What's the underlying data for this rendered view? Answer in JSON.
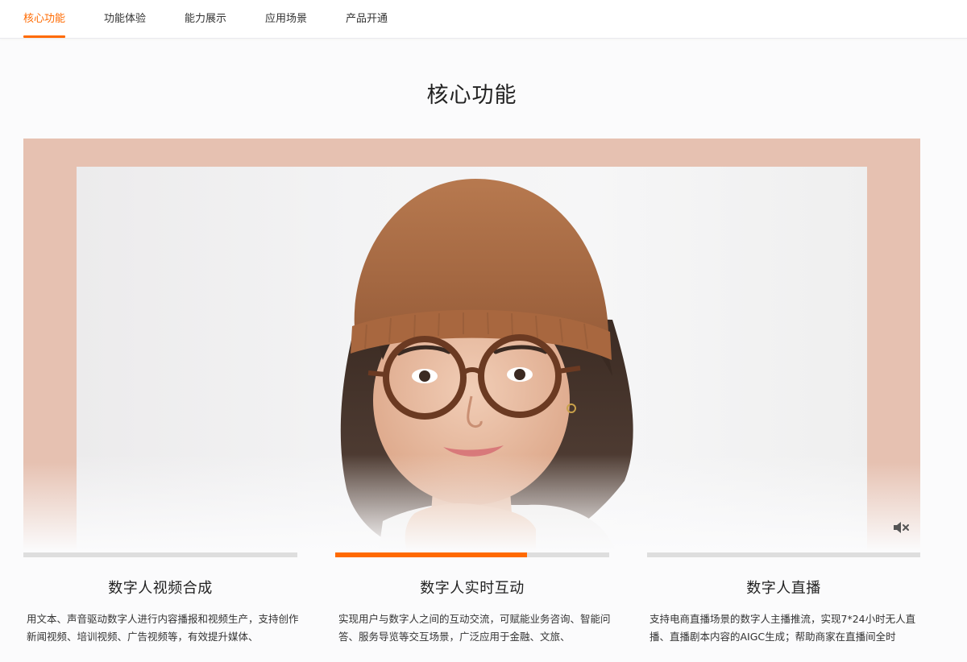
{
  "nav": {
    "tabs": [
      {
        "label": "核心功能",
        "active": true
      },
      {
        "label": "功能体验",
        "active": false
      },
      {
        "label": "能力展示",
        "active": false
      },
      {
        "label": "应用场景",
        "active": false
      },
      {
        "label": "产品开通",
        "active": false
      }
    ]
  },
  "section": {
    "title": "核心功能"
  },
  "media": {
    "type": "video",
    "muted": true,
    "mute_icon": "volume-mute-icon",
    "subject": "portrait"
  },
  "features": [
    {
      "title": "数字人视频合成",
      "description": "用文本、声音驱动数字人进行内容播报和视频生产，支持创作新闻视频、培训视频、广告视频等，有效提升媒体、",
      "progress": 0,
      "active": false
    },
    {
      "title": "数字人实时互动",
      "description": "实现用户与数字人之间的互动交流，可赋能业务咨询、智能问答、服务导览等交互场景，广泛应用于金融、文旅、",
      "progress": 0.7,
      "active": true
    },
    {
      "title": "数字人直播",
      "description": "支持电商直播场景的数字人主播推流，实现7*24小时无人直播、直播剧本内容的AIGC生成；帮助商家在直播间全时",
      "progress": 0,
      "active": false
    }
  ],
  "colors": {
    "accent": "#ff6a00",
    "stage_bg": "#e6c1b1",
    "progress_track": "#dedede"
  }
}
